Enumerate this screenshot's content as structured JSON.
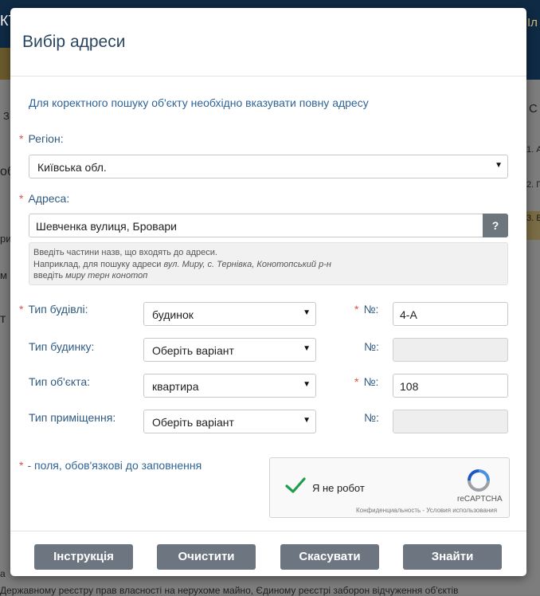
{
  "background": {
    "header_text": "Іл",
    "header_left": "КТ",
    "left_texts": [
      "З",
      "об",
      "ри",
      "м з",
      "т"
    ],
    "right_texts": [
      "С",
      "1. А",
      "2. П",
      "3. В"
    ],
    "bottom_text": "Державному реєстру прав власності на нерухоме майно, Єдиному реєстрі заборон відчуження об'єктів",
    "bottom_left": "а"
  },
  "modal": {
    "title": "Вибір адреси",
    "intro": "Для коректного пошуку об'єкту необхідно вказувати повну адресу",
    "region": {
      "label": "Регіон:",
      "value": "Київська обл."
    },
    "address": {
      "label": "Адреса:",
      "value": "Шевченка вулиця, Бровари",
      "help_button": "?",
      "hint_line1": "Введіть частини назв, що входять до адреси.",
      "hint_line2_prefix": "Наприклад, для пошуку адреси ",
      "hint_line2_example": "вул. Миру, с. Тернівка, Конотопський р-н",
      "hint_line3_prefix": "введіть ",
      "hint_line3_example": "миру терн конотоп"
    },
    "rows": [
      {
        "label": "Тип будівлі:",
        "required": true,
        "select": "будинок",
        "num_label": "№:",
        "num_required": true,
        "num_value": "4-А",
        "num_disabled": false
      },
      {
        "label": "Тип будинку:",
        "required": false,
        "select": "Оберіть варіант",
        "num_label": "№:",
        "num_required": false,
        "num_value": "",
        "num_disabled": true
      },
      {
        "label": "Тип об'єкта:",
        "required": false,
        "select": "квартира",
        "num_label": "№:",
        "num_required": true,
        "num_value": "108",
        "num_disabled": false
      },
      {
        "label": "Тип приміщення:",
        "required": false,
        "select": "Оберіть варіант",
        "num_label": "№:",
        "num_required": false,
        "num_value": "",
        "num_disabled": true
      }
    ],
    "required_note": "- поля, обов'язкові до заповнення",
    "required_mark": "*",
    "captcha": {
      "label": "Я не робот",
      "brand": "reCAPTCHA",
      "links": "Конфиденциальность - Условия использования",
      "checked": true
    },
    "buttons": {
      "instruction": "Інструкція",
      "clear": "Очистити",
      "cancel": "Скасувати",
      "find": "Знайти"
    }
  },
  "colors": {
    "label": "#2f5a80",
    "required": "#d9534f",
    "button": "#6d7680",
    "check": "#1e9e4a"
  }
}
